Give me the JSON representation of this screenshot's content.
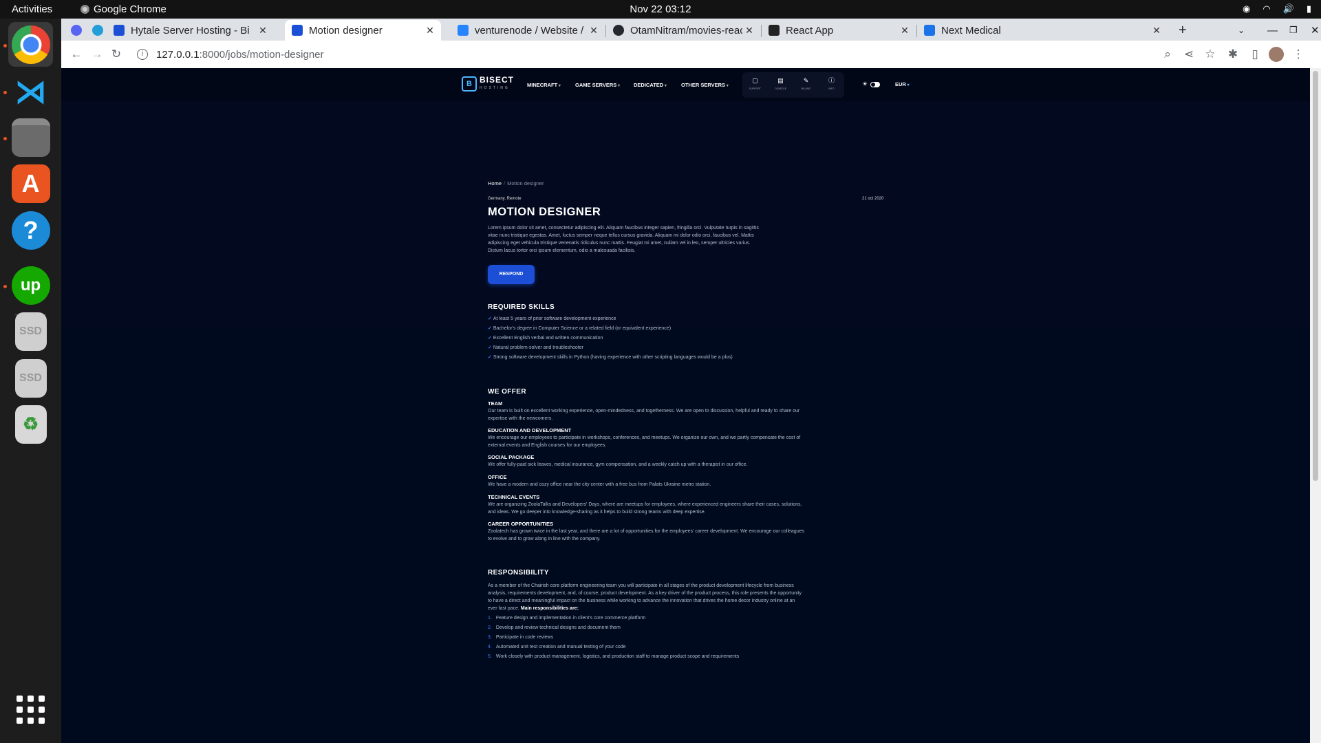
{
  "os": {
    "activities": "Activities",
    "app_name": "Google Chrome",
    "clock": "Nov 22  03:12"
  },
  "browser": {
    "tabs": [
      {
        "title": "",
        "color": "#5865f2"
      },
      {
        "title": "",
        "color": "#229ed9"
      },
      {
        "title": "Hytale Server Hosting - Bi",
        "color": "#1a4fd6"
      },
      {
        "title": "Motion designer",
        "color": "#1a4fd6"
      },
      {
        "title": "venturenode / Website / s",
        "color": "#2684ff"
      },
      {
        "title": "OtamNitram/movies-reac",
        "color": "#24292f"
      },
      {
        "title": "React App",
        "color": "#222222"
      },
      {
        "title": "Next Medical",
        "color": "#1a73e8"
      }
    ],
    "url_host": "127.0.0.1",
    "url_path": ":8000/jobs/motion-designer"
  },
  "site": {
    "logo_text": "BISECT",
    "logo_sub": "HOSTING",
    "nav": [
      "MINECRAFT",
      "GAME SERVERS",
      "DEDICATED",
      "OTHER SERVERS"
    ],
    "nav_icons": [
      {
        "icon": "support-icon",
        "label": "SUPPORT"
      },
      {
        "icon": "console-icon",
        "label": "CONSOLE"
      },
      {
        "icon": "billing-icon",
        "label": "BILLING"
      },
      {
        "icon": "info-icon",
        "label": "INFO"
      }
    ],
    "currency": "EUR"
  },
  "job": {
    "breadcrumb_home": "Home",
    "breadcrumb_current": "Motion designer",
    "location": "Germany, Remote",
    "date": "21 oct 2020",
    "title": "MOTION DESIGNER",
    "description": "Lorem ipsum dolor sit amet, consectetur adipiscing elit. Aliquam faucibus integer sapien, fringilla orci. Vulputate turpis in sagittis vitae nunc tristique egestas. Amet, luctus semper neque tellus cursus gravida. Aliquam mi dolor odio orci, faucibus vel. Mattis adipiscing eget vehicula tristique venenatis ridiculus nunc mattis. Feugiat mi amet, nullam vel in leo, semper ultricies varius. Dictum lacus tortor orci ipsum elementum, odio a malesuada facilisis.",
    "respond_label": "RESPOND"
  },
  "skills": {
    "title": "REQUIRED SKILLS",
    "items": [
      "At least 5 years of prior software development experience",
      "Bachelor's degree in Computer Science or a related field (or equivalent experience)",
      "Excellent English verbal and written communication",
      "Natural problem-solver and troubleshooter",
      "Strong software development skills in Python (having experience with other scripting languages would be a plus)"
    ]
  },
  "offer": {
    "title": "WE OFFER",
    "items": [
      {
        "heading": "TEAM",
        "text": "Our team is built on excellent working experience, open-mindedness, and togetherness. We are open to discussion, helpful and ready to share our expertise with the newcomers."
      },
      {
        "heading": "EDUCATION AND DEVELOPMENT",
        "text": "We encourage our employees to participate in workshops, conferences, and meetups. We organize our own, and we partly compensate the cost of external events and English courses for our employees."
      },
      {
        "heading": "SOCIAL PACKAGE",
        "text": "We offer fully-paid sick leaves, medical insurance, gym compensation, and a weekly catch up with a therapist in our office."
      },
      {
        "heading": "OFFICE",
        "text": "We have a modern and cozy office near the city center with a free bus from Palats Ukraine metro station."
      },
      {
        "heading": "TECHNICAL EVENTS",
        "text": "We are organizing ZoolaTalks and Developers' Days, where are meetups for employees, where experienced engineers share their cases, solutions, and ideas. We go deeper into knowledge-sharing as it helps to build strong teams with deep expertise."
      },
      {
        "heading": "CAREER OPPORTUNITIES",
        "text": "Zoolatech has grown twice in the last year, and there are a lot of opportunities for the employees' career development. We encourage our colleagues to evolve and to grow along in line with the company."
      }
    ]
  },
  "responsibility": {
    "title": "RESPONSIBILITY",
    "intro": "As a member of the Chairish core platform engineering team you will participate in all stages of the product development lifecycle from business analysis, requirements development, and, of course, product development. As a key driver of the product process, this role presents the opportunity to have a direct and meaningful impact on the business while working to advance the innovation that drives the home decor industry online at an ever fast pace.",
    "intro_bold": "Main responsibilities are:",
    "items": [
      "Feature design and implementation in client's core commerce platform",
      "Develop and review technical designs and document them",
      "Participate in code reviews",
      "Automated unit test creation and manual testing of your code",
      "Work closely with product management, logistics, and production staff to manage product scope and requirements"
    ]
  }
}
